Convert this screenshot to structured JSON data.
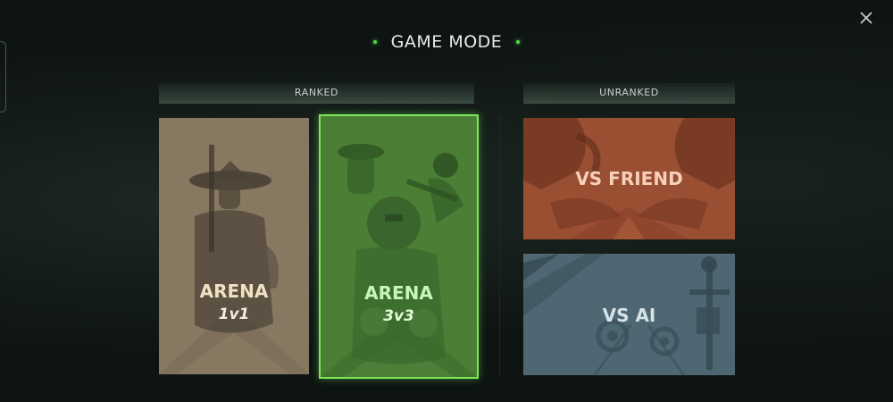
{
  "header": {
    "title": "GAME MODE",
    "close_icon": "close-icon"
  },
  "sections": {
    "ranked": {
      "label": "RANKED"
    },
    "unranked": {
      "label": "UNRANKED"
    }
  },
  "modes": {
    "arena_1v1": {
      "title": "ARENA",
      "subtitle": "1v1",
      "selected": false
    },
    "arena_3v3": {
      "title": "ARENA",
      "subtitle": "3v3",
      "selected": true
    },
    "vs_friend": {
      "title": "VS FRIEND",
      "selected": false
    },
    "vs_ai": {
      "title": "VS AI",
      "selected": false
    }
  },
  "colors": {
    "accent": "#7be85a",
    "arena_1v1_bg": "#877862",
    "arena_3v3_bg": "#4a7f35",
    "vs_friend_bg": "#9a4f33",
    "vs_ai_bg": "#4e6772"
  }
}
